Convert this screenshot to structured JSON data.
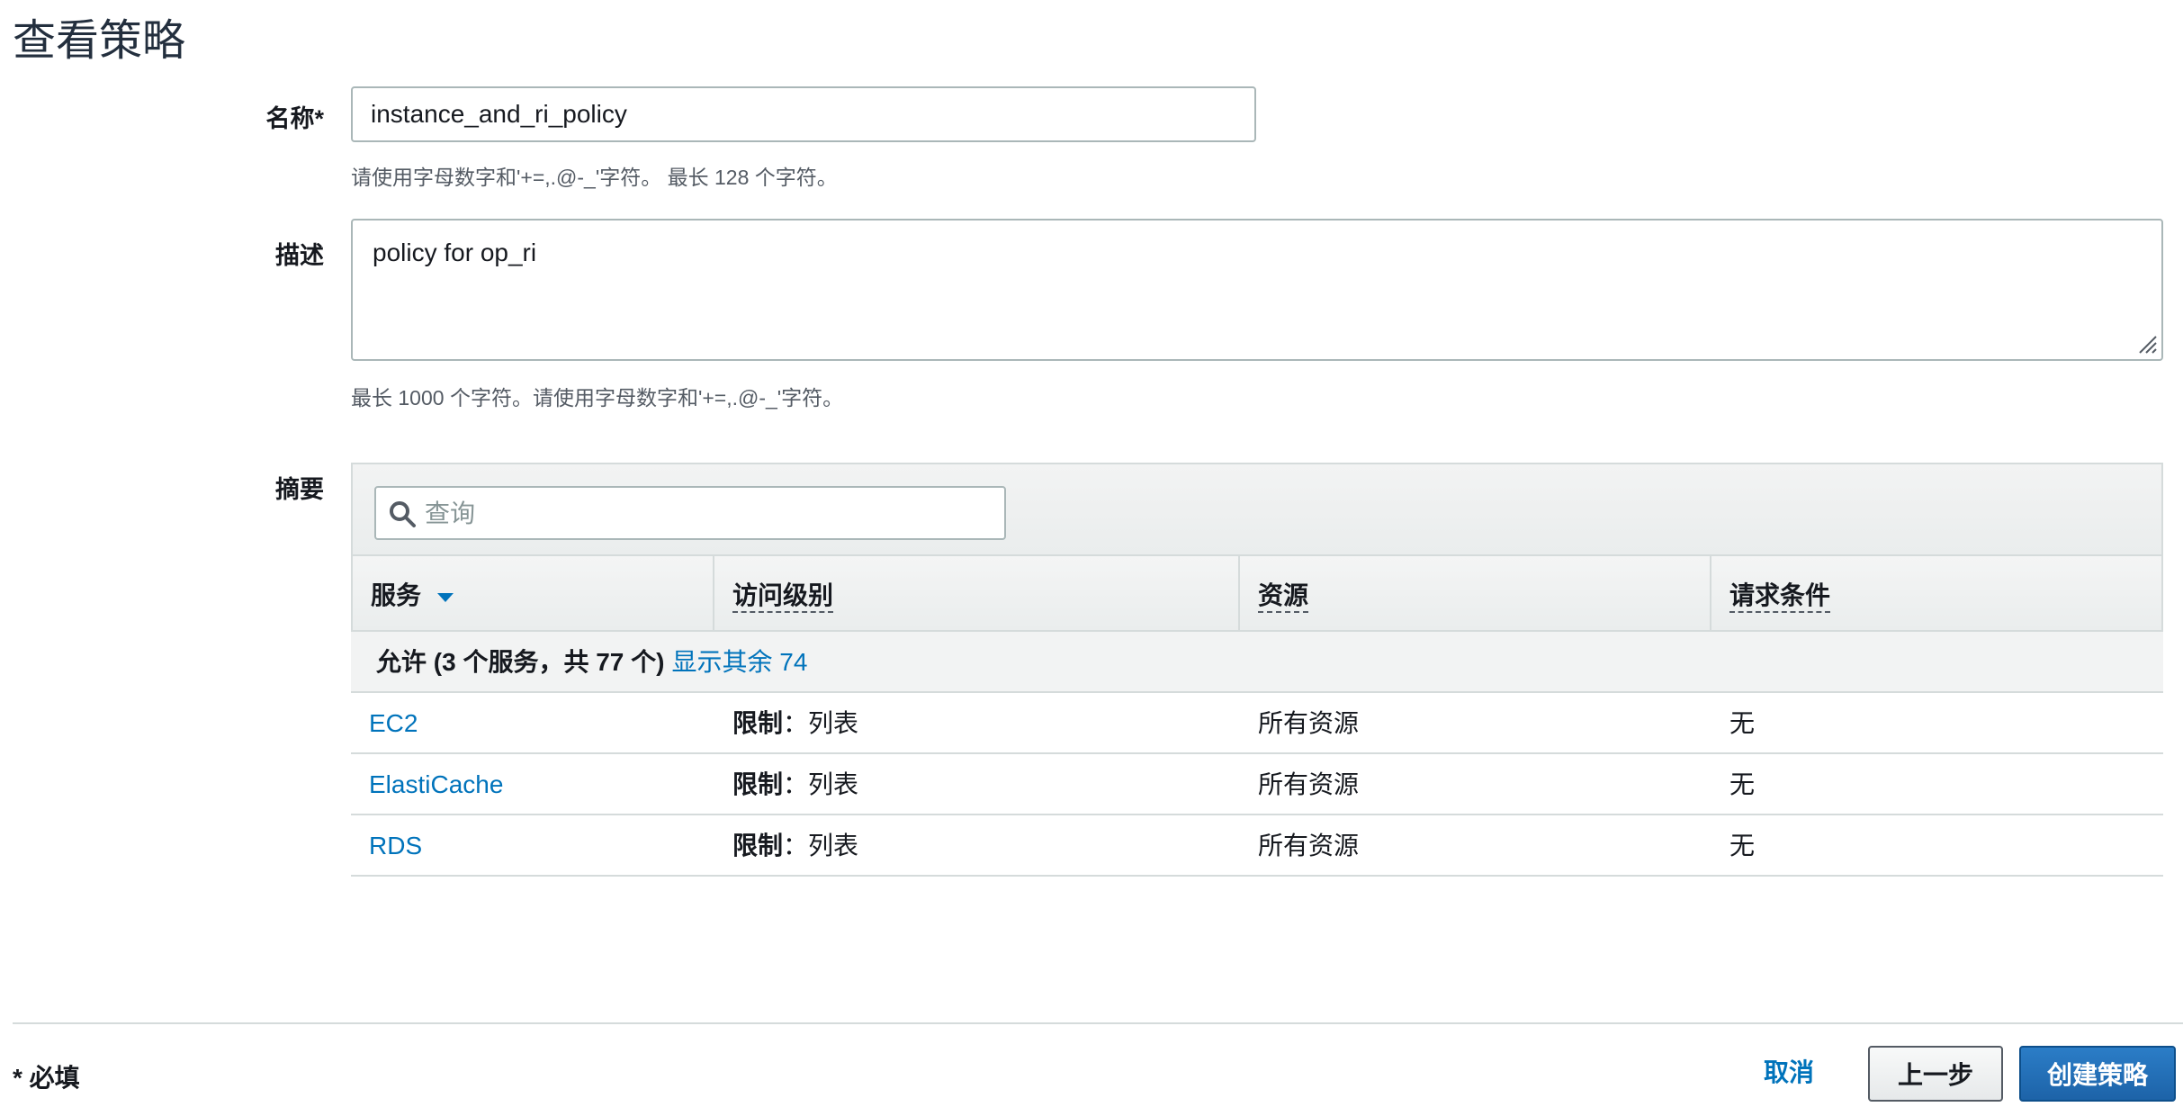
{
  "page": {
    "title": "查看策略"
  },
  "name_field": {
    "label": "名称*",
    "value": "instance_and_ri_policy",
    "hint": "请使用字母数字和'+=,.@-_'字符。 最长 128 个字符。"
  },
  "description_field": {
    "label": "描述",
    "value": "policy for op_ri",
    "hint": "最长 1000 个字符。请使用字母数字和'+=,.@-_'字符。"
  },
  "summary": {
    "label": "摘要",
    "search_placeholder": "查询",
    "columns": [
      "服务",
      "访问级别",
      "资源",
      "请求条件"
    ],
    "group": {
      "label": "允许 (3 个服务，共 77 个)",
      "link": "显示其余 74"
    },
    "rows": [
      {
        "service": "EC2",
        "access_bold": "限制",
        "access_sep": "：",
        "access": "列表",
        "resource": "所有资源",
        "condition": "无"
      },
      {
        "service": "ElastiCache",
        "access_bold": "限制",
        "access_sep": "：",
        "access": "列表",
        "resource": "所有资源",
        "condition": "无"
      },
      {
        "service": "RDS",
        "access_bold": "限制",
        "access_sep": "：",
        "access": "列表",
        "resource": "所有资源",
        "condition": "无"
      }
    ]
  },
  "footer": {
    "required_note": "* 必填",
    "cancel_label": "取消",
    "back_label": "上一步",
    "create_label": "创建策略"
  },
  "colors": {
    "link": "#0073bb",
    "primary_button": "#1d63a8",
    "border": "#d5dbdb"
  }
}
